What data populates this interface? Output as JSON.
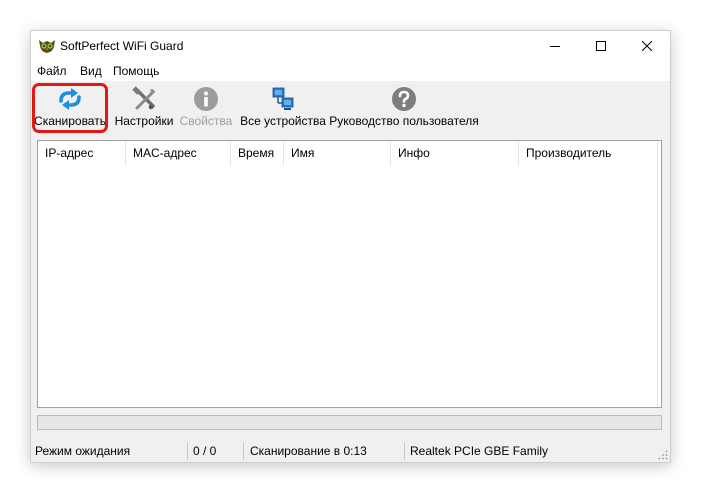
{
  "window": {
    "title": "SoftPerfect WiFi Guard"
  },
  "menu": [
    {
      "label": "Файл"
    },
    {
      "label": "Вид"
    },
    {
      "label": "Помощь"
    }
  ],
  "toolbar": {
    "scan": {
      "label": "Сканировать",
      "icon": "scan-arrows-icon",
      "enabled": true
    },
    "settings": {
      "label": "Настройки",
      "icon": "tools-icon",
      "enabled": true
    },
    "properties": {
      "label": "Свойства",
      "icon": "info-icon",
      "enabled": false
    },
    "all_devices": {
      "label": "Все устройства",
      "icon": "network-computers-icon",
      "enabled": true
    },
    "user_guide": {
      "label": "Руководство пользователя",
      "icon": "help-icon",
      "enabled": true
    }
  },
  "table": {
    "columns": [
      "IP-адрес",
      "MAC-адрес",
      "Время",
      "Имя",
      "Инфо",
      "Производитель"
    ],
    "rows": []
  },
  "progress": {
    "value": 0
  },
  "status": {
    "state": "Режим ожидания",
    "count": "0 / 0",
    "scan_time": "Сканирование в 0:13",
    "adapter": "Realtek PCIe GBE Family"
  },
  "colors": {
    "highlight": "#e01818",
    "scan_icon": "#1f8fe0",
    "window_bg": "#f0f0f0"
  }
}
